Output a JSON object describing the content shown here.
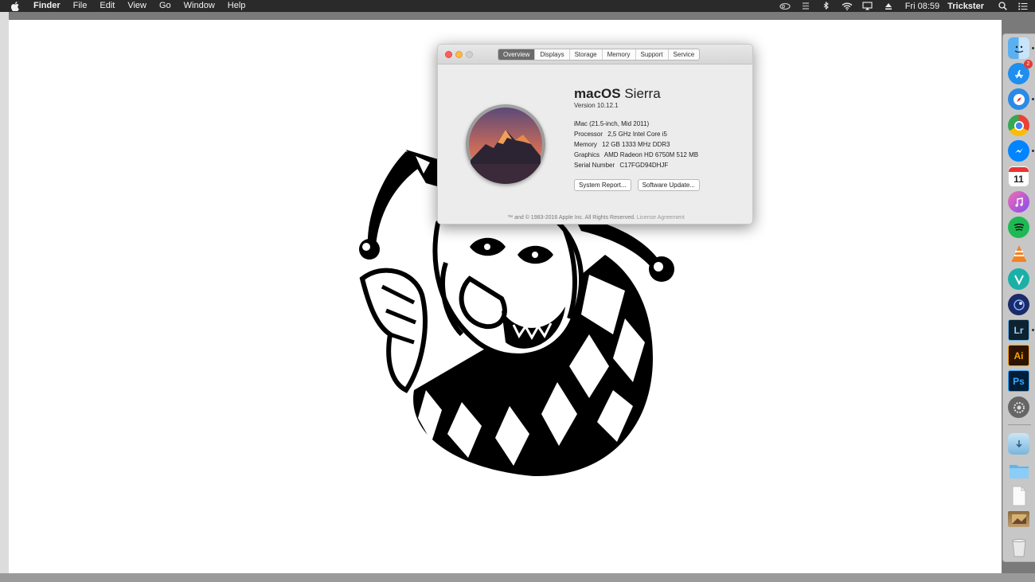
{
  "menubar": {
    "app_name": "Finder",
    "menus": [
      "File",
      "Edit",
      "View",
      "Go",
      "Window",
      "Help"
    ],
    "clock": "Fri 08:59",
    "user": "Trickster"
  },
  "about": {
    "tabs": [
      "Overview",
      "Displays",
      "Storage",
      "Memory",
      "Support",
      "Service"
    ],
    "active_tab": "Overview",
    "os_name_bold": "macOS",
    "os_name_light": "Sierra",
    "version": "Version 10.12.1",
    "model": "iMac (21.5-inch, Mid 2011)",
    "processor_label": "Processor",
    "processor_value": "2,5 GHz Intel Core i5",
    "memory_label": "Memory",
    "memory_value": "12 GB 1333 MHz DDR3",
    "graphics_label": "Graphics",
    "graphics_value": "AMD Radeon HD 6750M 512 MB",
    "serial_label": "Serial Number",
    "serial_value": "C17FGD94DHJF",
    "system_report_button": "System Report...",
    "software_update_button": "Software Update...",
    "footer": "™ and © 1983-2016 Apple Inc. All Rights Reserved.",
    "license_link": "License Agreement"
  },
  "dock": {
    "calendar_day": "11",
    "appstore_badge": "2",
    "lightroom_label": "Lr",
    "illustrator_label": "Ai",
    "photoshop_label": "Ps"
  },
  "colors": {
    "menubar": "#2a2a2a",
    "canvas": "#ffffff",
    "window_bg": "#ececec"
  }
}
